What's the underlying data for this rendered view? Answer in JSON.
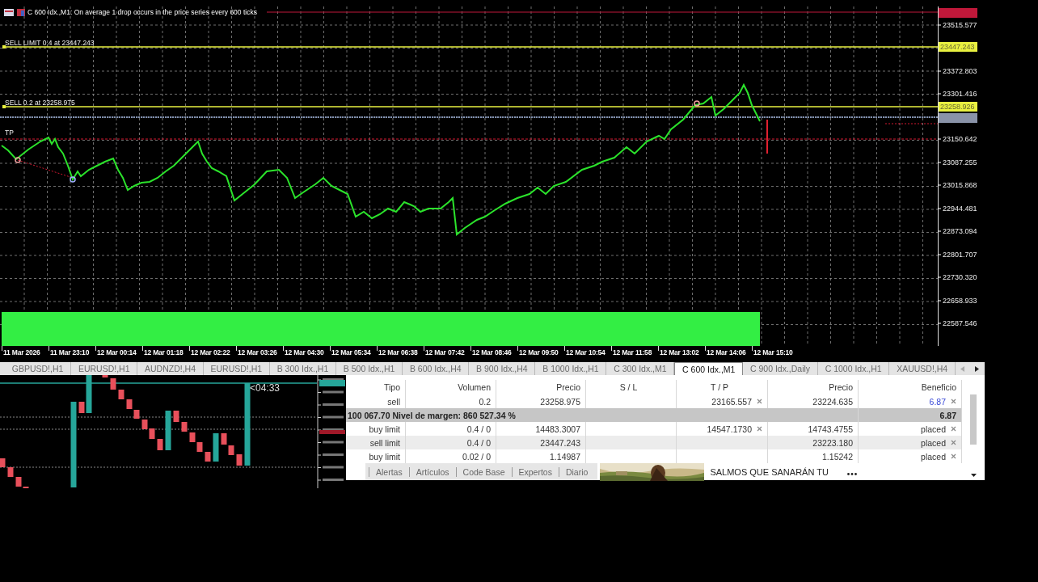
{
  "chart": {
    "title": "C 600 Idx.,M1:  On average 1 drop occurs in the price series every 600 ticks",
    "order_labels": [
      {
        "text": "SELL LIMIT 0.4 at 23447.243",
        "kind": "sell_limit"
      },
      {
        "text": "SELL 0.2 at 23258.975",
        "kind": "sell"
      },
      {
        "text": "TP",
        "kind": "tp"
      }
    ],
    "price_axis": [
      "23515.577",
      "23372.803",
      "23301.416",
      "23150.642",
      "23087.255",
      "23015.868",
      "22944.481",
      "22873.094",
      "22801.707",
      "22730.320",
      "22658.933",
      "22587.546"
    ],
    "price_tags": [
      {
        "text": "23447.243",
        "kind": "limit"
      },
      {
        "text": "23258.926",
        "kind": "position"
      }
    ],
    "time_axis": [
      "11 Mar 2026",
      "11 Mar 23:10",
      "12 Mar 00:14",
      "12 Mar 01:18",
      "12 Mar 02:22",
      "12 Mar 03:26",
      "12 Mar 04:30",
      "12 Mar 05:34",
      "12 Mar 06:38",
      "12 Mar 07:42",
      "12 Mar 08:46",
      "12 Mar 09:50",
      "12 Mar 10:54",
      "12 Mar 11:58",
      "12 Mar 13:02",
      "12 Mar 14:06",
      "12 Mar 15:10"
    ]
  },
  "chart_tabs": [
    {
      "label": "GBPUSD!,H1",
      "selected": false
    },
    {
      "label": "EURUSD!,H1",
      "selected": false
    },
    {
      "label": "AUDNZD!,H4",
      "selected": false
    },
    {
      "label": "EURUSD!,H1",
      "selected": false
    },
    {
      "label": "B 300 Idx.,H1",
      "selected": false
    },
    {
      "label": "B 500 Idx.,H1",
      "selected": false
    },
    {
      "label": "B 600 Idx.,H4",
      "selected": false
    },
    {
      "label": "B 900 Idx.,H4",
      "selected": false
    },
    {
      "label": "B 1000 Idx.,H1",
      "selected": false
    },
    {
      "label": "C 300 Idx.,M1",
      "selected": false
    },
    {
      "label": "C 600 Idx.,M1",
      "selected": true
    },
    {
      "label": "C 900 Idx.,Daily",
      "selected": false
    },
    {
      "label": "C 1000 Idx.,H1",
      "selected": false
    },
    {
      "label": "XAUUSD!,H4",
      "selected": false
    }
  ],
  "mini_chart": {
    "countdown": "<04:33"
  },
  "trade_table": {
    "columns": [
      "Tipo",
      "Volumen",
      "Precio",
      "S / L",
      "T / P",
      "Precio",
      "Beneficio"
    ],
    "rows": [
      {
        "kind": "position",
        "cells": [
          "sell",
          "0.2",
          "23258.975",
          "",
          "23165.557",
          "23224.635",
          "6.87"
        ]
      },
      {
        "kind": "summary",
        "cells": [
          "100 067.70  Nivel de margen: 860 527.34 %",
          "6.87"
        ]
      },
      {
        "kind": "pending",
        "cells": [
          "buy limit",
          "0.4 / 0",
          "14483.3007",
          "",
          "14547.1730",
          "14743.4755",
          "placed"
        ]
      },
      {
        "kind": "pending",
        "cells": [
          "sell limit",
          "0.4 / 0",
          "23447.243",
          "",
          "",
          "23223.180",
          "placed"
        ]
      },
      {
        "kind": "pending",
        "cells": [
          "buy limit",
          "0.02 / 0",
          "1.14987",
          "",
          "",
          "1.15242",
          "placed"
        ]
      }
    ]
  },
  "terminal_tabs": [
    "Alertas",
    "Artículos",
    "Code Base",
    "Expertos",
    "Diario"
  ],
  "ad": {
    "headline": "SALMOS QUE SANARÁN TU"
  }
}
